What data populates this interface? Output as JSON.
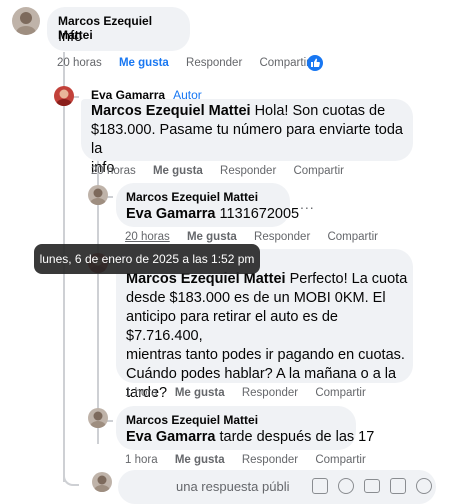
{
  "comments": [
    {
      "author": "Marcos Ezequiel Mattei",
      "text": "Info",
      "time": "20 horas",
      "like": "Me gusta",
      "reply": "Responder",
      "share": "Compartir"
    },
    {
      "author": "Eva Gamarra",
      "badge": "Autor",
      "mention": "Marcos Ezequiel Mattei",
      "text_lines": [
        "Hola! Son cuotas de",
        "$183.000. Pasame tu número para enviarte toda la",
        "info"
      ],
      "time": "20 horas",
      "like": "Me gusta",
      "reply": "Responder",
      "share": "Compartir"
    },
    {
      "author": "Marcos Ezequiel Mattei",
      "mention": "Eva Gamarra",
      "text": "1131672005",
      "more": "...",
      "time": "20 horas",
      "like": "Me gusta",
      "reply": "Responder",
      "share": "Compartir"
    },
    {
      "mention": "Marcos Ezequiel Mattei",
      "text_lines": [
        "Perfecto! La cuota",
        "desde $183.000 es de un MOBI 0KM. El",
        "anticipo para retirar el auto es de $7.716.400,",
        "mientras tanto podes ir pagando en cuotas.",
        "Cuándo podes hablar? A la mañana o a la",
        "tarde?"
      ],
      "time": "1 hora",
      "like": "Me gusta",
      "reply": "Responder",
      "share": "Compartir"
    },
    {
      "author": "Marcos Ezequiel Mattei",
      "mention": "Eva Gamarra",
      "text": "tarde después de las 17",
      "time": "1 hora",
      "like": "Me gusta",
      "reply": "Responder",
      "share": "Compartir"
    }
  ],
  "tooltip": "lunes, 6 de enero de 2025 a las 1:52 pm",
  "reply_placeholder": "una respuesta públi",
  "colors": {
    "accent": "#1877f2",
    "bubble": "#f0f2f5",
    "muted": "#65676b"
  }
}
